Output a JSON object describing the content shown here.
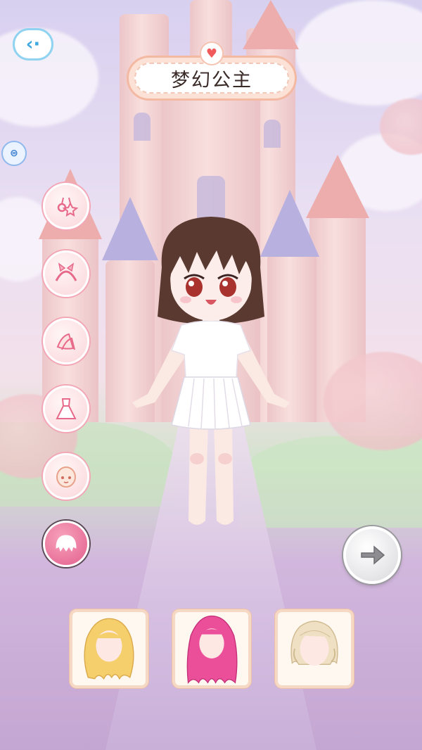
{
  "header": {
    "back_icon": "back-arrow-icon",
    "side_icon": "coin-icon",
    "title": "梦幻公主",
    "title_icon": "heart-icon"
  },
  "categories": [
    {
      "name": "accessory",
      "icon": "earrings-icon",
      "active": false
    },
    {
      "name": "headband",
      "icon": "headband-icon",
      "active": false
    },
    {
      "name": "shoes",
      "icon": "shoes-icon",
      "active": false
    },
    {
      "name": "dress",
      "icon": "dress-icon",
      "active": false
    },
    {
      "name": "face",
      "icon": "face-icon",
      "active": false
    },
    {
      "name": "hair",
      "icon": "hair-icon",
      "active": true
    }
  ],
  "next_button": {
    "icon": "arrow-right-icon"
  },
  "hair_options": [
    {
      "name": "hair-option-blonde-wavy",
      "color": "#f5cf6b"
    },
    {
      "name": "hair-option-pink-long",
      "color": "#ec4f9a"
    },
    {
      "name": "hair-option-cream-braid",
      "color": "#efe0c4"
    }
  ],
  "colors": {
    "accent_pink": "#e35f8d",
    "title_border": "#f3b9a3",
    "back_blue": "#3ea8df"
  }
}
